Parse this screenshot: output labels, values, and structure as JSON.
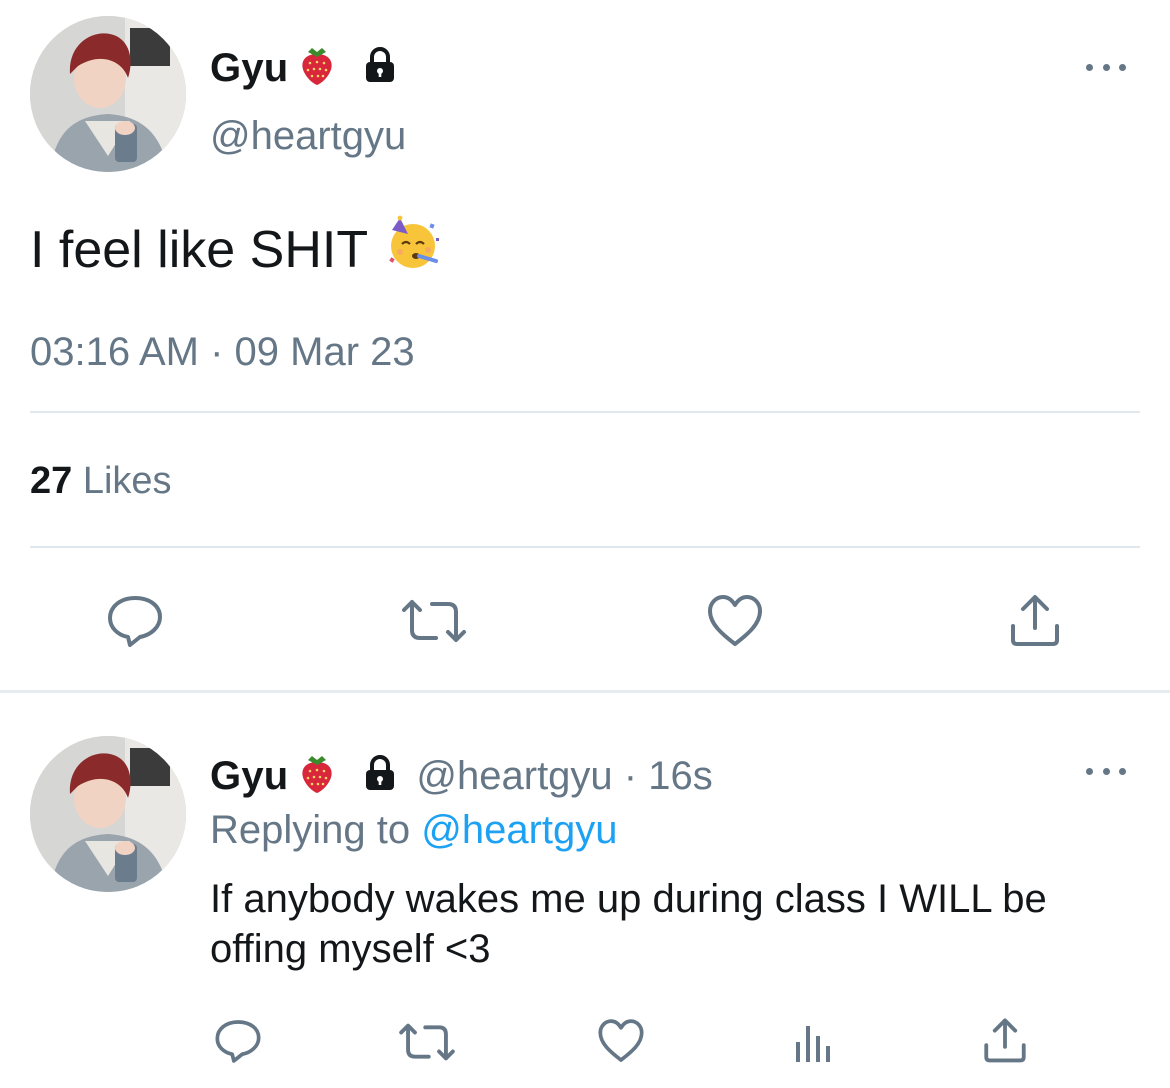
{
  "main_tweet": {
    "display_name": "Gyu",
    "name_emoji": "strawberry",
    "lock_icon": "lock-icon",
    "handle": "@heartgyu",
    "text": "I feel like SHIT",
    "text_emoji": "partying-face",
    "timestamp": "03:16 AM · 09 Mar 23",
    "likes_count": "27",
    "likes_label": "Likes",
    "actions": [
      "reply-icon",
      "retweet-icon",
      "heart-icon",
      "share-icon"
    ]
  },
  "reply_tweet": {
    "display_name": "Gyu",
    "name_emoji": "strawberry",
    "lock_icon": "lock-icon",
    "handle_time": "@heartgyu · 16s",
    "replying_prefix": "Replying to",
    "replying_mention": "@heartgyu",
    "text": "If anybody wakes me up during class I WILL be offing myself <3",
    "actions": [
      "reply-icon",
      "retweet-icon",
      "heart-icon",
      "analytics-icon",
      "share-icon"
    ]
  },
  "colors": {
    "text_primary": "#14171a",
    "text_secondary": "#657786",
    "link": "#1da1f2",
    "divider": "#e1e8ed"
  }
}
